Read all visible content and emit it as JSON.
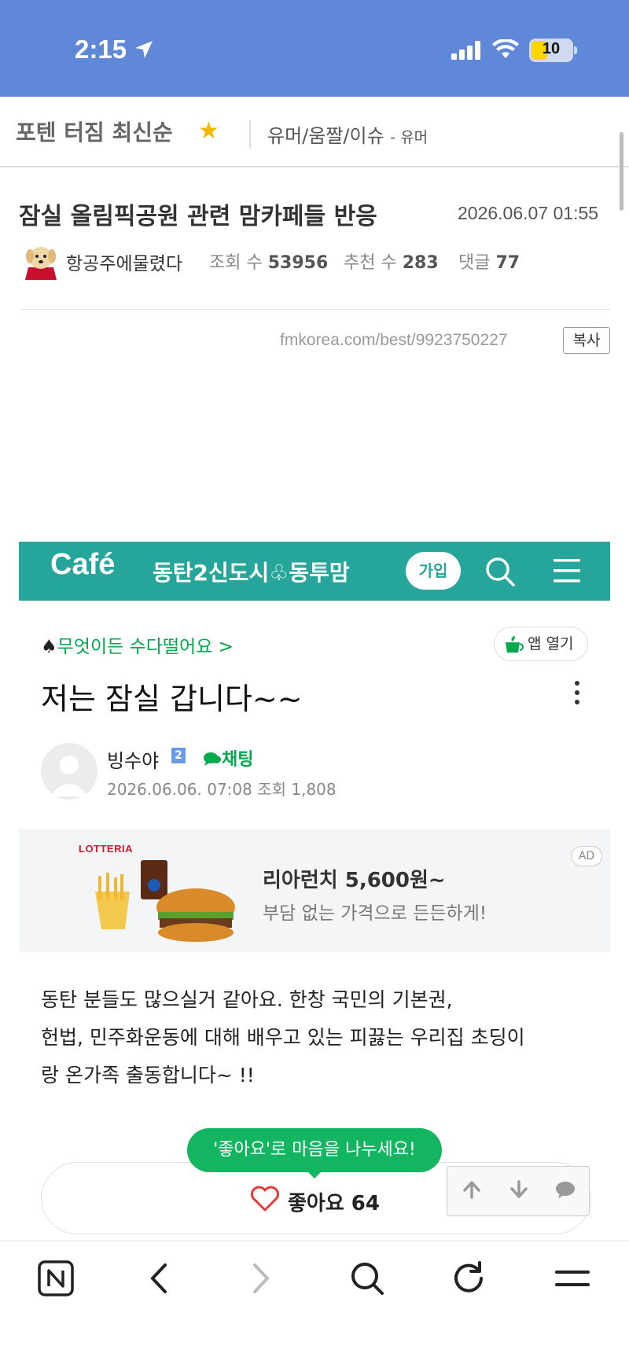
{
  "status": {
    "time": "2:15",
    "battery": "10"
  },
  "board": {
    "title": "포텐 터짐 최신순",
    "category": "유머/움짤/이슈",
    "sub": "- 유머"
  },
  "post": {
    "title": "잠실 올림픽공원 관련 맘카페들 반응",
    "date": "2026.06.07 01:55",
    "author": "항공주에물렸다",
    "views_label": "조회 수",
    "views": "53956",
    "recommend_label": "추천 수",
    "recommend": "283",
    "comments_label": "댓글",
    "comments": "77",
    "url": "fmkorea.com/best/9923750227",
    "copy_label": "복사"
  },
  "cafe": {
    "logo": "Café",
    "name": "동탄2신도시♧동투맘",
    "join_label": "가입",
    "breadcrumb": "무엇이든 수다떨어요 >",
    "app_open_label": "앱 열기",
    "title": "저는 잠실 갑니다~~",
    "writer": "빙수야",
    "level": "2",
    "chat_label": "채팅",
    "meta": "2026.06.06. 07:08  조회 1,808",
    "ad": {
      "brand": "LOTTERIA",
      "headline": "리아런치 5,600원~",
      "sub": "부담 없는 가격으로 든든하게!",
      "badge": "AD"
    },
    "body": [
      "동탄 분들도 많으실거 같아요. 한창 국민의 기본권,",
      "헌법, 민주화운동에 대해 배우고 있는 피끓는 우리집 초딩이",
      "랑 온가족 출동합니다~ !!"
    ],
    "like_tip": "'좋아요'로 마음을 나누세요!",
    "like_label": "좋아요 64"
  },
  "icons": [
    "location-arrow-icon",
    "signal-icon",
    "wifi-icon",
    "battery-icon",
    "star-icon",
    "search-icon",
    "menu-icon",
    "cup-icon",
    "kebab-icon",
    "chat-icon",
    "heart-icon",
    "up-arrow-icon",
    "down-arrow-icon",
    "comment-icon",
    "naver-icon",
    "back-icon",
    "forward-icon",
    "refresh-icon"
  ],
  "colors": {
    "status_bar": "#5f88d8",
    "cafe_green": "#26a69a",
    "naver_green": "#03a94d",
    "tip_green": "#13b560"
  }
}
